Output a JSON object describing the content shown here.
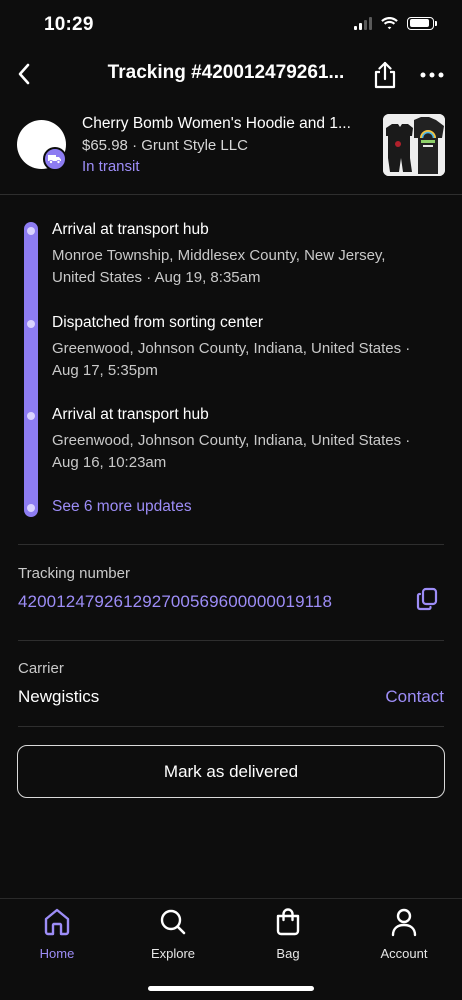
{
  "status_bar": {
    "time": "10:29",
    "signal_icon": "cellular-signal-icon",
    "wifi_icon": "wifi-icon",
    "battery_icon": "battery-icon",
    "battery_level": 0.9
  },
  "header": {
    "title": "Tracking #420012479261...",
    "back_icon": "chevron-left-icon",
    "share_icon": "share-icon",
    "more_icon": "more-horizontal-icon"
  },
  "product": {
    "name": "Cherry Bomb Women's Hoodie and 1...",
    "price": "$65.98",
    "separator": "·",
    "seller": "Grunt Style LLC",
    "status": "In transit",
    "badge_icon": "truck-icon"
  },
  "timeline": {
    "events": [
      {
        "title": "Arrival at transport hub",
        "detail_line1": "Monroe Township, Middlesex County, New Jersey,",
        "detail_line2": "United States · Aug 19, 8:35am"
      },
      {
        "title": "Dispatched from sorting center",
        "detail_line1": "Greenwood, Johnson County, Indiana, United States ·",
        "detail_line2": "Aug 17, 5:35pm"
      },
      {
        "title": "Arrival at transport hub",
        "detail_line1": "Greenwood, Johnson County, Indiana, United States ·",
        "detail_line2": "Aug 16, 10:23am"
      }
    ],
    "see_more_label": "See 6 more updates"
  },
  "tracking": {
    "label": "Tracking number",
    "number": "420012479261292700569600000019118",
    "copy_icon": "copy-icon"
  },
  "carrier": {
    "label": "Carrier",
    "name": "Newgistics",
    "contact_label": "Contact"
  },
  "actions": {
    "mark_delivered_label": "Mark as delivered"
  },
  "tab_bar": {
    "tabs": [
      {
        "label": "Home",
        "icon": "home-icon",
        "active": true
      },
      {
        "label": "Explore",
        "icon": "search-icon",
        "active": false
      },
      {
        "label": "Bag",
        "icon": "bag-icon",
        "active": false
      },
      {
        "label": "Account",
        "icon": "person-icon",
        "active": false
      }
    ]
  },
  "colors": {
    "accent": "#9d8df7",
    "timeline": "#8d7cf2",
    "background": "#0d0d0d",
    "text": "#ffffff",
    "secondary_text": "#c9c9c9"
  }
}
